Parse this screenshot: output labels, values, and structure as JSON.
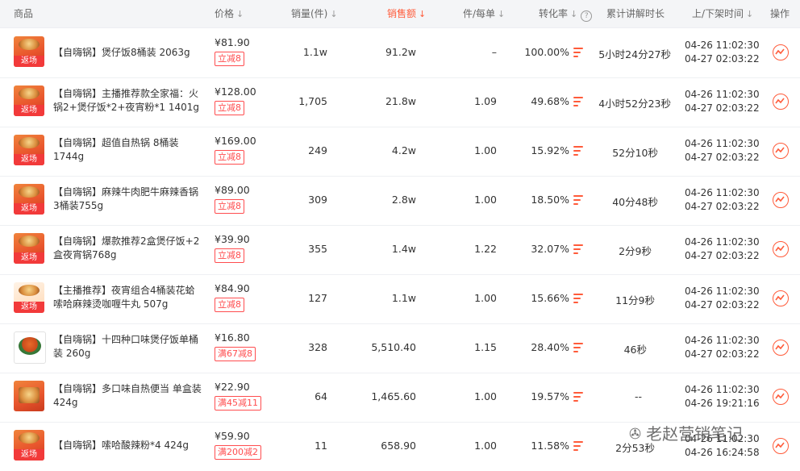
{
  "header": {
    "product": "商品",
    "price": "价格",
    "sales_qty": "销量(件)",
    "sales_amount": "销售额",
    "per_order": "件/每单",
    "conversion": "转化率",
    "explain_time": "累计讲解时长",
    "shelf_time": "上/下架时间",
    "action": "操作"
  },
  "rows": [
    {
      "name": "【自嗨锅】煲仔饭8桶装 2063g",
      "tag": "返场",
      "price": "¥81.90",
      "badge": "立减8",
      "qty": "1.1w",
      "amount": "91.2w",
      "per_order": "–",
      "conversion": "100.00%",
      "explain": "5小时24分27秒",
      "on": "04-26  11:02:30",
      "off": "04-27  02:03:22"
    },
    {
      "name": "【自嗨锅】主播推荐款全家福：火锅2+煲仔饭*2+夜宵粉*1 1401g",
      "tag": "返场",
      "price": "¥128.00",
      "badge": "立减8",
      "qty": "1,705",
      "amount": "21.8w",
      "per_order": "1.09",
      "conversion": "49.68%",
      "explain": "4小时52分23秒",
      "on": "04-26  11:02:30",
      "off": "04-27  02:03:22"
    },
    {
      "name": "【自嗨锅】超值自热锅 8桶装 1744g",
      "tag": "返场",
      "price": "¥169.00",
      "badge": "立减8",
      "qty": "249",
      "amount": "4.2w",
      "per_order": "1.00",
      "conversion": "15.92%",
      "explain": "52分10秒",
      "on": "04-26  11:02:30",
      "off": "04-27  02:03:22"
    },
    {
      "name": "【自嗨锅】麻辣牛肉肥牛麻辣香锅3桶装755g",
      "tag": "返场",
      "price": "¥89.00",
      "badge": "立减8",
      "qty": "309",
      "amount": "2.8w",
      "per_order": "1.00",
      "conversion": "18.50%",
      "explain": "40分48秒",
      "on": "04-26  11:02:30",
      "off": "04-27  02:03:22"
    },
    {
      "name": "【自嗨锅】爆款推荐2盒煲仔饭+2盒夜宵锅768g",
      "tag": "返场",
      "price": "¥39.90",
      "badge": "立减8",
      "qty": "355",
      "amount": "1.4w",
      "per_order": "1.22",
      "conversion": "32.07%",
      "explain": "2分9秒",
      "on": "04-26  11:02:30",
      "off": "04-27  02:03:22"
    },
    {
      "name": "【主播推荐】夜宵组合4桶装花蛤嗦哈麻辣烫咖喱牛丸 507g",
      "tag": "返场",
      "price": "¥84.90",
      "badge": "立减8",
      "qty": "127",
      "amount": "1.1w",
      "per_order": "1.00",
      "conversion": "15.66%",
      "explain": "11分9秒",
      "on": "04-26  11:02:30",
      "off": "04-27  02:03:22"
    },
    {
      "name": "【自嗨锅】十四种口味煲仔饭单桶装 260g",
      "tag": "",
      "price": "¥16.80",
      "badge": "满67减8",
      "qty": "328",
      "amount": "5,510.40",
      "per_order": "1.15",
      "conversion": "28.40%",
      "explain": "46秒",
      "on": "04-26  11:02:30",
      "off": "04-27  02:03:22"
    },
    {
      "name": "【自嗨锅】多口味自热便当 单盒装424g",
      "tag": "",
      "price": "¥22.90",
      "badge": "满45减11",
      "qty": "64",
      "amount": "1,465.60",
      "per_order": "1.00",
      "conversion": "19.57%",
      "explain": "--",
      "on": "04-26  11:02:30",
      "off": "04-26  19:21:16"
    },
    {
      "name": "【自嗨锅】嗦哈酸辣粉*4 424g",
      "tag": "返场",
      "price": "¥59.90",
      "badge": "满200减2",
      "qty": "11",
      "amount": "658.90",
      "per_order": "1.00",
      "conversion": "11.58%",
      "explain": "2分53秒",
      "on": "04-26  11:02:30",
      "off": "04-26  16:24:58"
    }
  ],
  "watermark": "老赵营销笔记",
  "colors": {
    "accent": "#ff5b3a",
    "badge": "#ff4d4f",
    "tag_bg": "#f23a3a",
    "header_bg": "#f4f5f7"
  },
  "icons": {
    "sort": "arrow-down-icon",
    "help": "question-circle-icon",
    "conversion_bars": "bars-icon",
    "trend": "trend-chart-icon",
    "wechat": "wechat-logo-icon"
  }
}
